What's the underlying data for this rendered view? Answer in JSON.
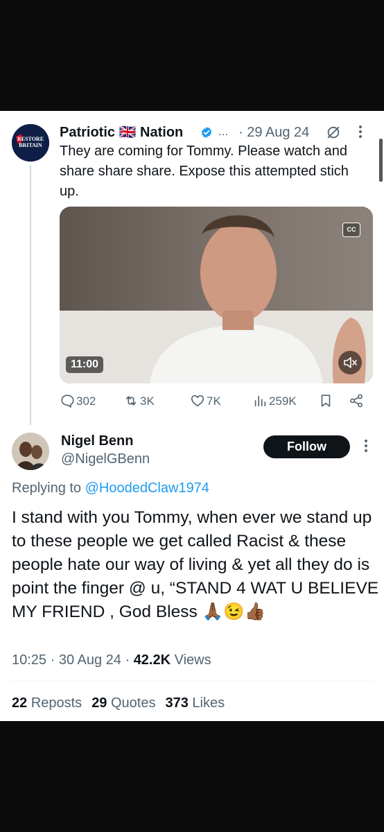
{
  "parent_tweet": {
    "author_name": "Patriotic 🇬🇧 Nation",
    "avatar_text_line1": "RESTORE",
    "avatar_text_line2": "BRITAIN",
    "truncation": "...",
    "date": "· 29 Aug 24",
    "text": "They are coming for Tommy. Please watch and share share share. Expose this attempted stich up.",
    "video": {
      "cc_label": "CC",
      "duration": "11:00"
    },
    "actions": {
      "replies": "302",
      "reposts": "3K",
      "likes": "7K",
      "views": "259K"
    }
  },
  "reply": {
    "author_name": "Nigel Benn",
    "handle": "@NigelGBenn",
    "follow_label": "Follow",
    "replying_prefix": "Replying to ",
    "replying_to": "@HoodedClaw1974",
    "text": "I stand with you Tommy, when ever we stand up to these people we get called Racist & these people hate our way of living & yet all they do is point the finger @ u, “STAND 4 WAT U BELIEVE MY FRIEND , God Bless 🙏🏾😉👍🏾",
    "time": "10:25 · 30 Aug 24 · ",
    "views_count": "42.2K",
    "views_label": " Views",
    "stats": {
      "reposts_count": "22",
      "reposts_label": " Reposts",
      "quotes_count": "29",
      "quotes_label": " Quotes",
      "likes_count": "373",
      "likes_label": " Likes"
    }
  },
  "colors": {
    "text_primary": "#0f1419",
    "text_secondary": "#536471",
    "link": "#1d9bf0",
    "verified": "#1d9bf0",
    "page_background": "#0b0b0b"
  }
}
